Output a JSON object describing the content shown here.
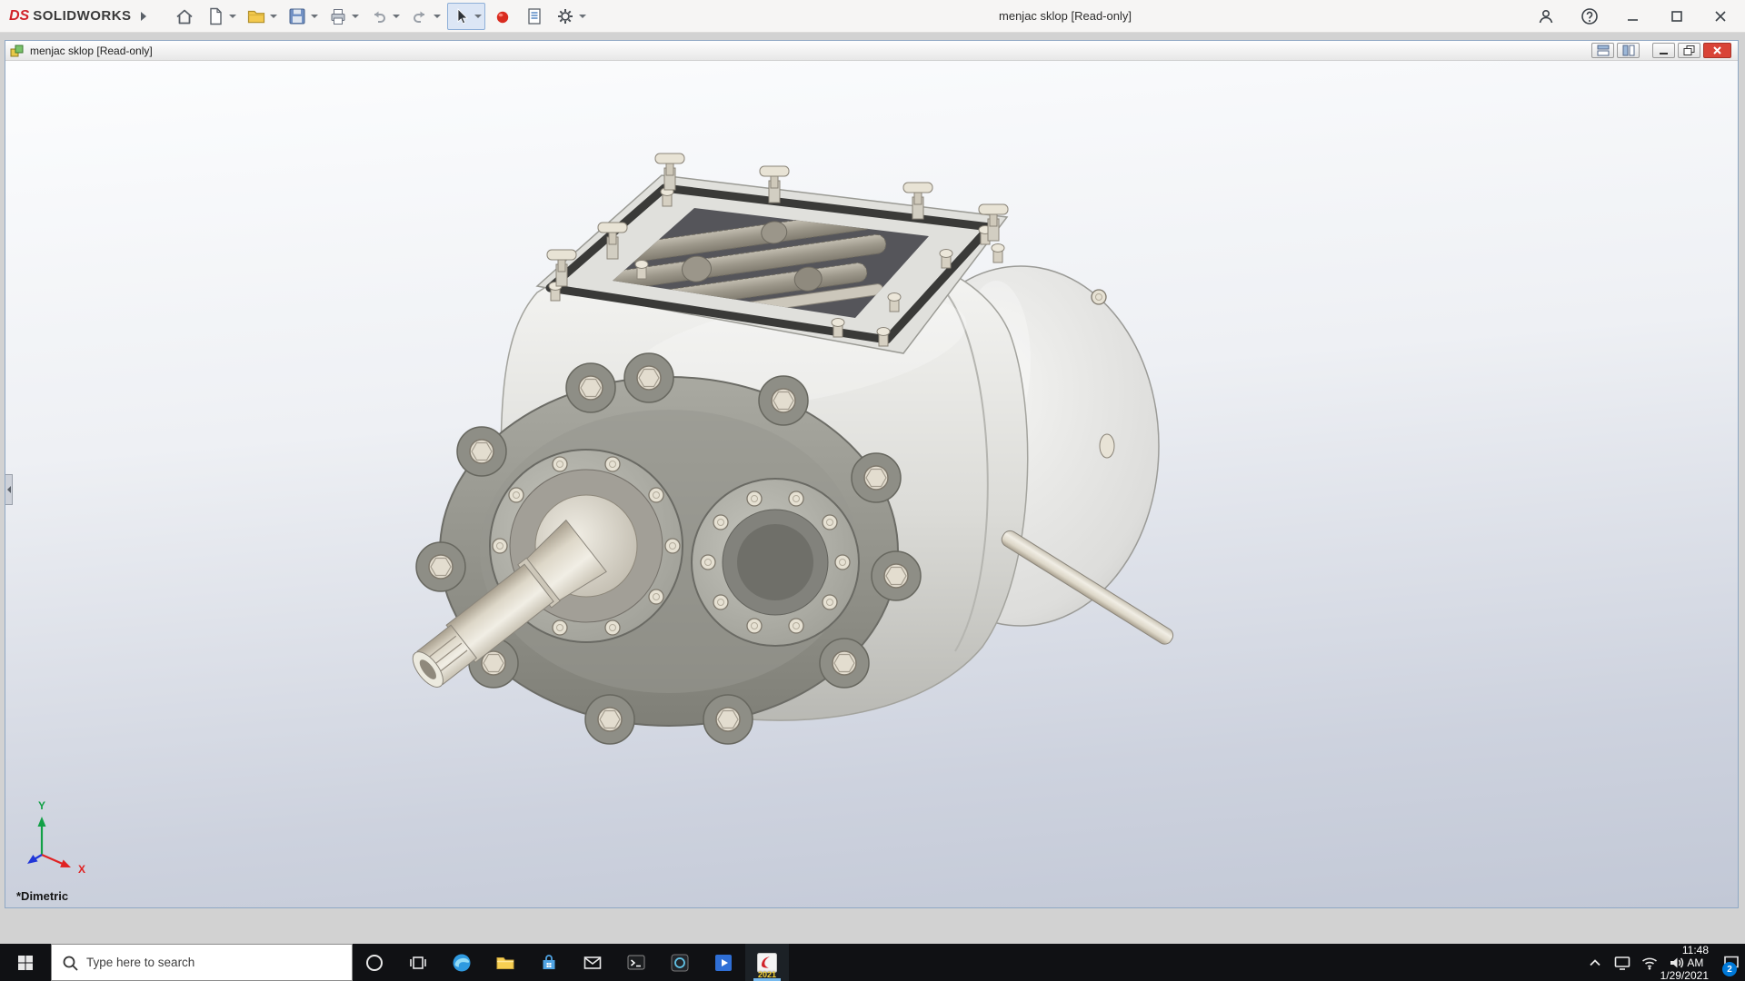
{
  "brand": {
    "ds": "DS",
    "name": "SOLIDWORKS"
  },
  "app": {
    "title": "menjac sklop [Read-only]"
  },
  "toolbar": {
    "icons": [
      "home",
      "new-document",
      "open",
      "save",
      "print",
      "undo",
      "redo",
      "select",
      "3dexperience",
      "file-properties",
      "options"
    ]
  },
  "document": {
    "title": "menjac sklop [Read-only]",
    "view_label": "*Dimetric",
    "triad": {
      "x": "X",
      "y": "Y"
    }
  },
  "taskbar": {
    "search_placeholder": "Type here to search",
    "apps": [
      "start",
      "cortana",
      "task-view",
      "edge",
      "file-explorer",
      "store",
      "mail",
      "terminal",
      "photos",
      "movies-tv",
      "solidworks"
    ],
    "solidworks_year": "2021",
    "clock": {
      "time": "11:48 AM",
      "date": "1/29/2021"
    },
    "notifications_count": "2"
  },
  "colors": {
    "close_red": "#d94437",
    "badge_blue": "#0078d7",
    "brand_red": "#d1232a",
    "select_highlight": "#dce6f5",
    "taskbar_bg": "#101114"
  }
}
